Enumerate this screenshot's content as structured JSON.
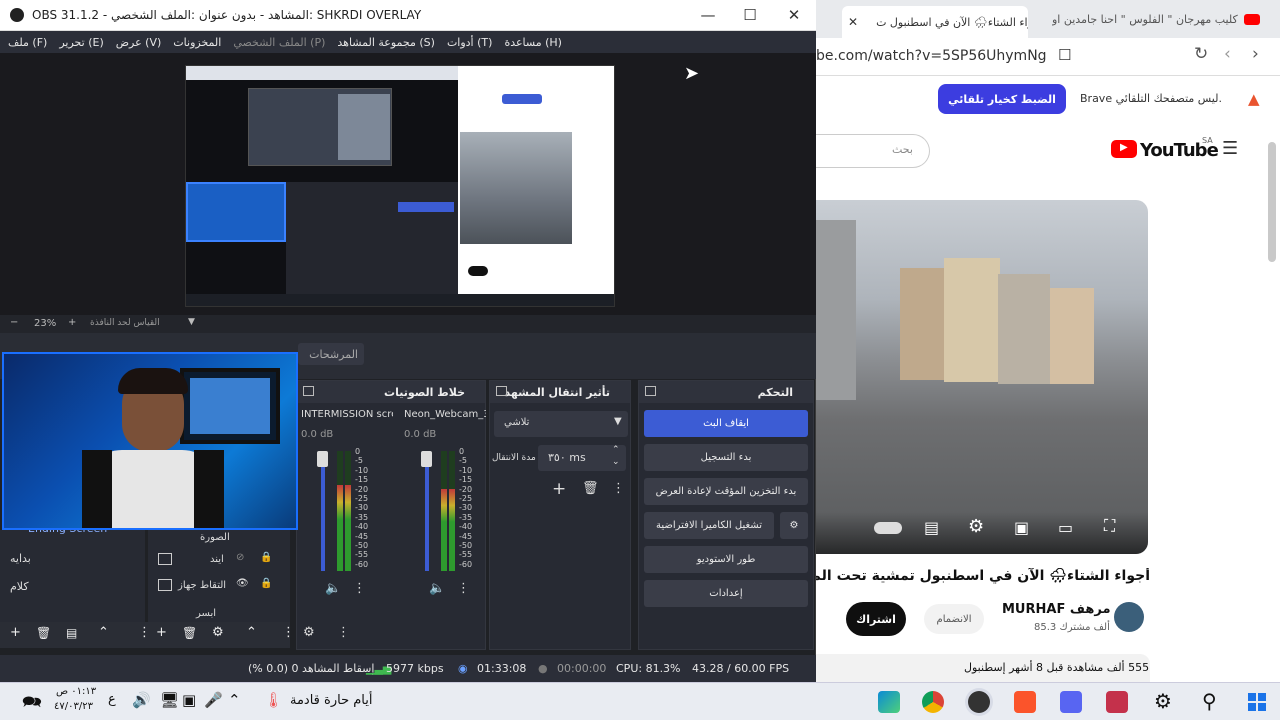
{
  "obs": {
    "title": "OBS 31.1.2 - المشاهد - بدون عنوان :الملف الشخصي: SHKRDI OVERLAY",
    "menu": [
      "ملف (F)",
      "تحرير (E)",
      "عرض (V)",
      "المخزونات",
      "الملف الشخصي (P)",
      "مجموعة المشاهد (S)",
      "أدوات (T)",
      "مساعدة (H)"
    ],
    "zoom": "23%",
    "zoom_hint": "القياس لحد النافذة",
    "filters_label": "المرشحات",
    "mixer": {
      "title": "خلاط الصوتيات",
      "channels": [
        {
          "name": "INTERMISSION scre",
          "db": "0.0 dB",
          "level": 0.72
        },
        {
          "name": "Neon_Webcam_3",
          "db": "0.0 dB",
          "level": 0.68
        }
      ],
      "scale": [
        "0",
        "-5",
        "-10",
        "-15",
        "-20",
        "-25",
        "-30",
        "-35",
        "-40",
        "-45",
        "-50",
        "-55",
        "-60"
      ]
    },
    "transition": {
      "title": "تأثير انتقال المشهد",
      "type": "تلاشي",
      "duration_label": "مدة الانتقال",
      "duration_value": "٣٥٠ ms"
    },
    "controls": {
      "title": "التحكم",
      "buttons": [
        "ايقاف البث",
        "بدء التسجيل",
        "بدء التخزين المؤقت لإعادة العرض",
        "تشغيل الكاميرا الافتراضية",
        "طور الاستوديو",
        "إعدادات"
      ]
    },
    "scenes": [
      "Ending Screen",
      "بدايه",
      "كلام"
    ],
    "sources": [
      "الصورة",
      "ايند",
      "التقاط جهاز",
      "ابسر"
    ],
    "status": {
      "dropped": "إسقاط المشاهد 0 (0.0 %)",
      "bitrate": "5977 kbps",
      "stream_time": "01:33:08",
      "rec_time": "00:00:00",
      "cpu": "CPU: 81.3%",
      "fps": "43.28 / 60.00 FPS"
    }
  },
  "browser": {
    "tabs": [
      {
        "label": "أجواء الشتاء🌧 الآن في اسطنبول ت"
      },
      {
        "label": "كليب مهرجان \" الفلوس \" احنا جامدين او"
      }
    ],
    "url": "be.com/watch?v=5SP56UhymNg",
    "brave_notice": "Brave ليس متصفحك التلقائي.",
    "brave_button": "الضبط كخيار تلقائي",
    "search_placeholder": "بحث",
    "logo": "YouTube",
    "region": "SA",
    "video_title": "أجواء الشتاء🌧 الآن في اسطنبول تمشية تحت المطر م",
    "channel_name": "MURHAF مرهف",
    "subscribers": "85.3 ألف مشترك",
    "subscribe_btn": "اشتراك",
    "join_btn": "الانضمام",
    "views": "555 ألف مشاهدة قبل 8 أشهر إسطنبول"
  },
  "taskbar": {
    "weather": "أيام حارة قادمة",
    "time": "٠١:١٣ ص",
    "date": "٤٧/٠٣/٢٣",
    "lang": "ع"
  }
}
